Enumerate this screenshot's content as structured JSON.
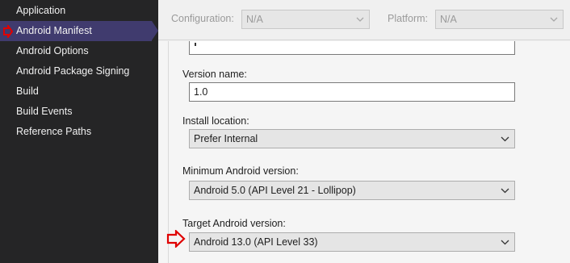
{
  "sidebar": {
    "items": [
      {
        "label": "Application"
      },
      {
        "label": "Android Manifest"
      },
      {
        "label": "Android Options"
      },
      {
        "label": "Android Package Signing"
      },
      {
        "label": "Build"
      },
      {
        "label": "Build Events"
      },
      {
        "label": "Reference Paths"
      }
    ],
    "selected_index": 1
  },
  "toolbar": {
    "configuration_label": "Configuration:",
    "configuration_value": "N/A",
    "platform_label": "Platform:",
    "platform_value": "N/A"
  },
  "form": {
    "version_name_label": "Version name:",
    "version_name_value": "1.0",
    "install_location_label": "Install location:",
    "install_location_value": "Prefer Internal",
    "min_android_label": "Minimum Android version:",
    "min_android_value": "Android 5.0 (API Level 21 - Lollipop)",
    "target_android_label": "Target Android version:",
    "target_android_value": "Android 13.0 (API Level 33)"
  },
  "colors": {
    "sidebar_bg": "#252526",
    "sidebar_selected": "#403b6e",
    "callout_red": "#e00000"
  }
}
